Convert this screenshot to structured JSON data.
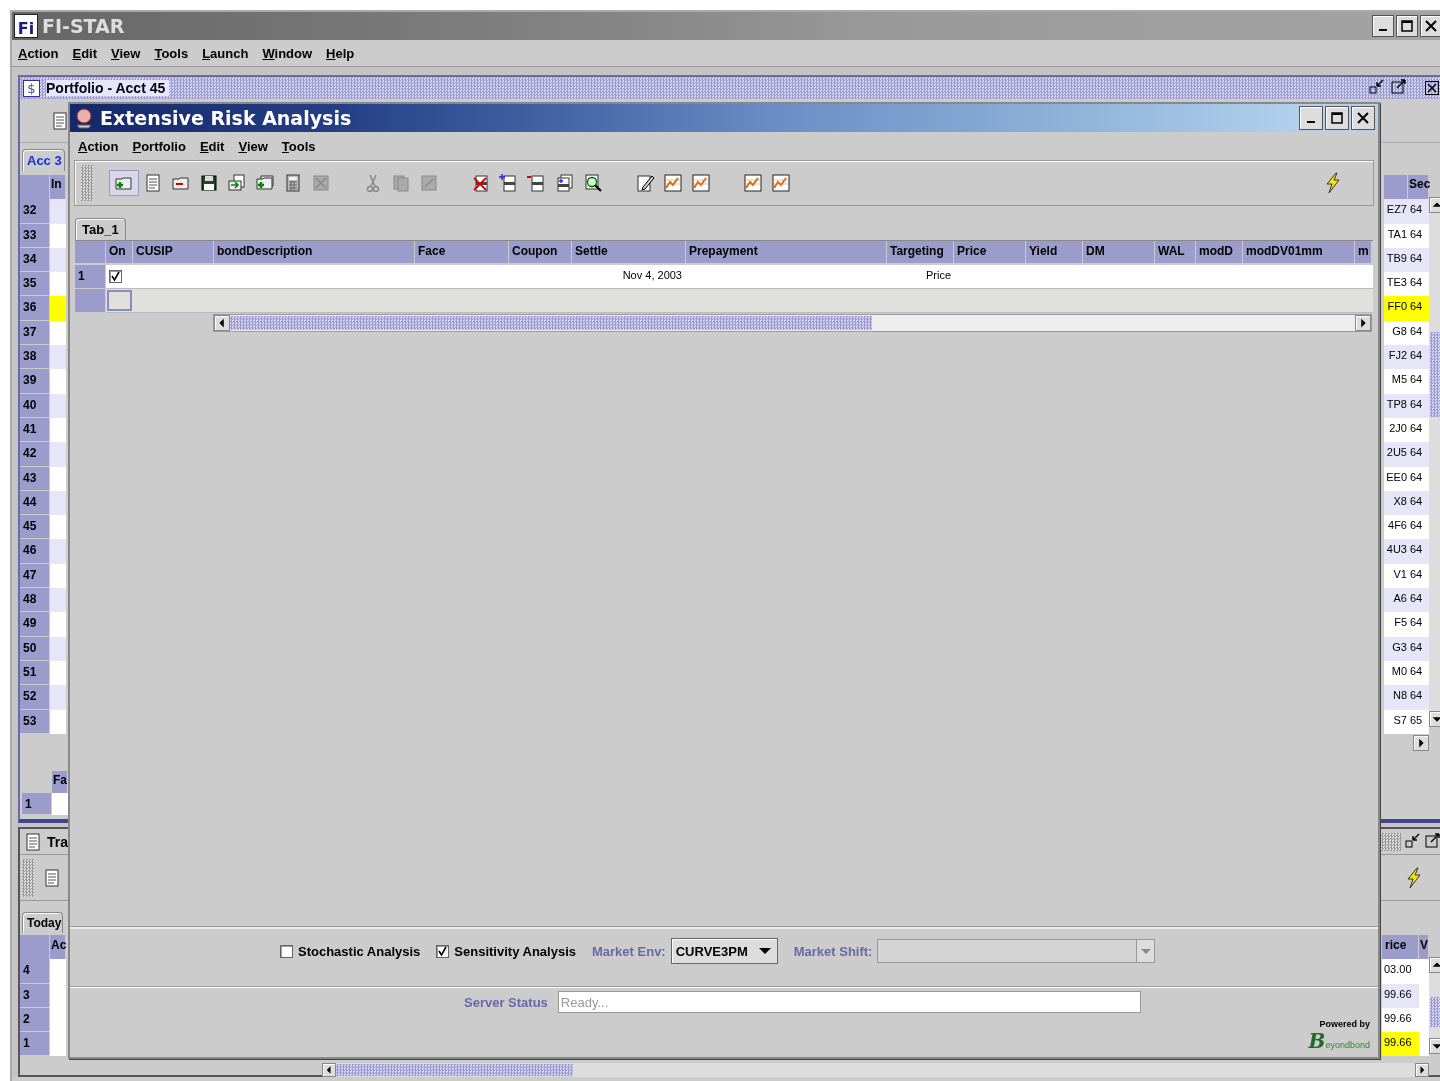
{
  "app": {
    "logo": "Fi",
    "title": "FI-STAR",
    "menu": [
      "Action",
      "Edit",
      "View",
      "Tools",
      "Launch",
      "Window",
      "Help"
    ]
  },
  "portfolio_window": {
    "icon": "$",
    "title": "Portfolio - Acct 45",
    "tab": "Acc 3",
    "header_left": "In",
    "header_right": "Sec",
    "rows": [
      {
        "number": "32",
        "code": "EZ7",
        "value": "64",
        "highlighted": false
      },
      {
        "number": "33",
        "code": "TA1",
        "value": "64",
        "highlighted": false
      },
      {
        "number": "34",
        "code": "TB9",
        "value": "64",
        "highlighted": false
      },
      {
        "number": "35",
        "code": "TE3",
        "value": "64",
        "highlighted": false
      },
      {
        "number": "36",
        "code": "FF0",
        "value": "64",
        "highlighted": true
      },
      {
        "number": "37",
        "code": "G8",
        "value": "64",
        "highlighted": false
      },
      {
        "number": "38",
        "code": "FJ2",
        "value": "64",
        "highlighted": false
      },
      {
        "number": "39",
        "code": "M5",
        "value": "64",
        "highlighted": false
      },
      {
        "number": "40",
        "code": "TP8",
        "value": "64",
        "highlighted": false
      },
      {
        "number": "41",
        "code": "2J0",
        "value": "64",
        "highlighted": false
      },
      {
        "number": "42",
        "code": "2U5",
        "value": "64",
        "highlighted": false
      },
      {
        "number": "43",
        "code": "EE0",
        "value": "64",
        "highlighted": false
      },
      {
        "number": "44",
        "code": "X8",
        "value": "64",
        "highlighted": false
      },
      {
        "number": "45",
        "code": "4F6",
        "value": "64",
        "highlighted": false
      },
      {
        "number": "46",
        "code": "4U3",
        "value": "64",
        "highlighted": false
      },
      {
        "number": "47",
        "code": "V1",
        "value": "64",
        "highlighted": false
      },
      {
        "number": "48",
        "code": "A6",
        "value": "64",
        "highlighted": false
      },
      {
        "number": "49",
        "code": "F5",
        "value": "64",
        "highlighted": false
      },
      {
        "number": "50",
        "code": "G3",
        "value": "64",
        "highlighted": false
      },
      {
        "number": "51",
        "code": "M0",
        "value": "64",
        "highlighted": false
      },
      {
        "number": "52",
        "code": "N8",
        "value": "64",
        "highlighted": false
      },
      {
        "number": "53",
        "code": "S7",
        "value": "65",
        "highlighted": false
      }
    ],
    "footer_header": "Fa",
    "footer_row": "1"
  },
  "transactions_window": {
    "title": "Tra",
    "tab": "Today",
    "header_left": "Ac",
    "header_right": [
      "rice",
      "V"
    ],
    "rows": [
      {
        "number": "4",
        "value": "03.00",
        "highlighted": false
      },
      {
        "number": "3",
        "value": "99.66",
        "highlighted": false
      },
      {
        "number": "2",
        "value": "99.66",
        "highlighted": false
      },
      {
        "number": "1",
        "value": "99.66",
        "highlighted": true
      }
    ]
  },
  "risk_window": {
    "title": "Extensive Risk Analysis",
    "menu": [
      "Action",
      "Portfolio",
      "Edit",
      "View",
      "Tools"
    ],
    "tab": "Tab_1",
    "columns": [
      "On",
      "CUSIP",
      "bondDescription",
      "Face",
      "Coupon",
      "Settle",
      "Prepayment",
      "Targeting",
      "Price",
      "Yield",
      "DM",
      "WAL",
      "modD",
      "modDV01mm",
      "m"
    ],
    "rows": [
      {
        "number": "1",
        "on": true,
        "settle": "Nov 4, 2003",
        "targeting": "Price"
      }
    ],
    "options": [
      {
        "kind": "checkbox",
        "label": "Stochastic Analysis",
        "checked": false
      },
      {
        "kind": "checkbox",
        "label": "Sensitivity Analysis",
        "checked": true
      },
      {
        "kind": "combo",
        "label": "Market Env:",
        "value": "CURVE3PM"
      },
      {
        "kind": "field",
        "label": "Market Shift:",
        "disabled": true
      }
    ],
    "server_status": {
      "label": "Server Status",
      "placeholder": "Ready..."
    },
    "powered_by": {
      "label": "Powered by",
      "brand": "Beyondbond"
    }
  }
}
